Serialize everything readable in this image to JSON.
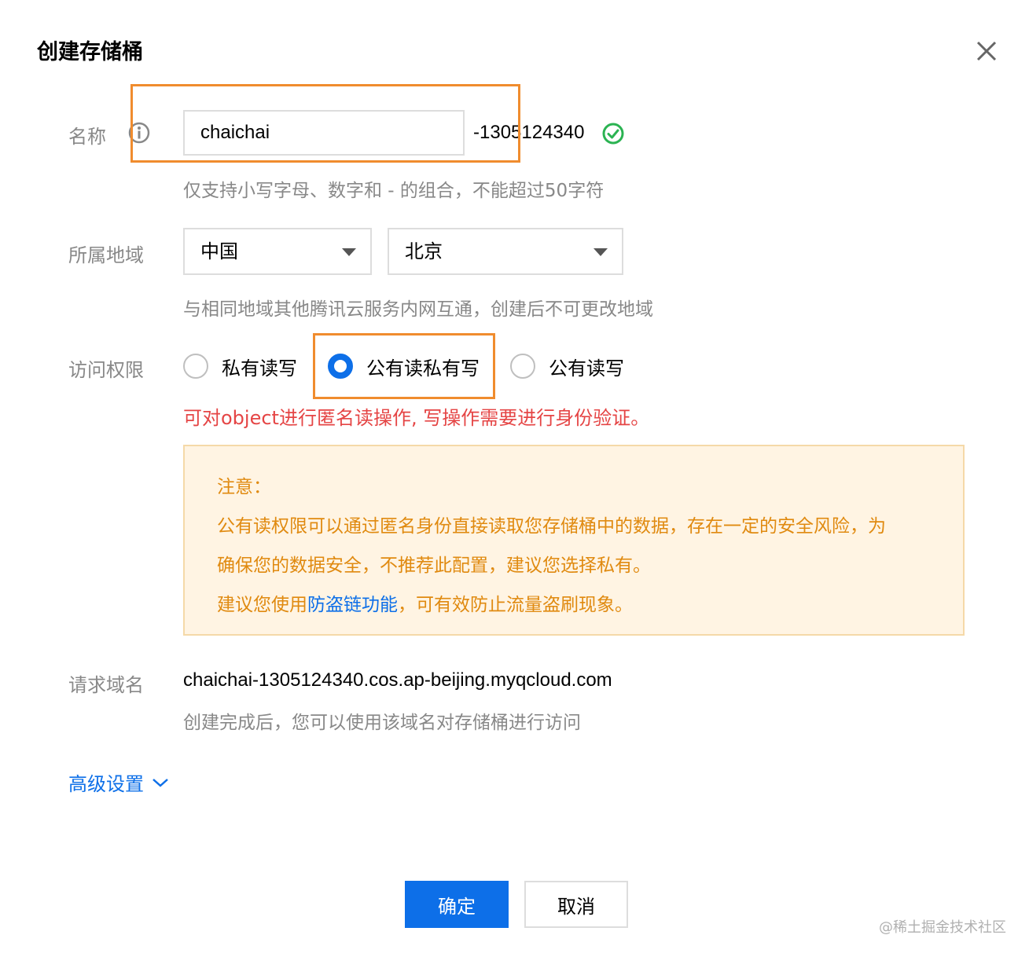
{
  "dialog": {
    "title": "创建存储桶"
  },
  "name_field": {
    "label": "名称",
    "value": "chaichai",
    "suffix": "-1305124340",
    "hint": "仅支持小写字母、数字和 - 的组合，不能超过50字符"
  },
  "region": {
    "label": "所属地域",
    "country": "中国",
    "city": "北京",
    "hint": "与相同地域其他腾讯云服务内网互通，创建后不可更改地域"
  },
  "access": {
    "label": "访问权限",
    "options": [
      {
        "label": "私有读写",
        "selected": false
      },
      {
        "label": "公有读私有写",
        "selected": true
      },
      {
        "label": "公有读写",
        "selected": false
      }
    ],
    "description": "可对object进行匿名读操作, 写操作需要进行身份验证。"
  },
  "notice": {
    "title": "注意：",
    "line1": "公有读权限可以通过匿名身份直接读取您存储桶中的数据，存在一定的安全风险，为",
    "line2": "确保您的数据安全，不推荐此配置，建议您选择私有。",
    "line3_prefix": "建议您使用",
    "line3_link": "防盗链功能",
    "line3_suffix": "，可有效防止流量盗刷现象。"
  },
  "request_domain": {
    "label": "请求域名",
    "value": "chaichai-1305124340.cos.ap-beijing.myqcloud.com",
    "hint": "创建完成后，您可以使用该域名对存储桶进行访问"
  },
  "advanced": {
    "label": "高级设置"
  },
  "buttons": {
    "ok": "确定",
    "cancel": "取消"
  },
  "watermark": "@稀土掘金技术社区",
  "colors": {
    "primary": "#0d6fe8",
    "highlight": "#f08c2e",
    "error": "#e54545",
    "warning_text": "#e08a10",
    "warning_bg": "#fff4e3",
    "success": "#2bb352"
  }
}
